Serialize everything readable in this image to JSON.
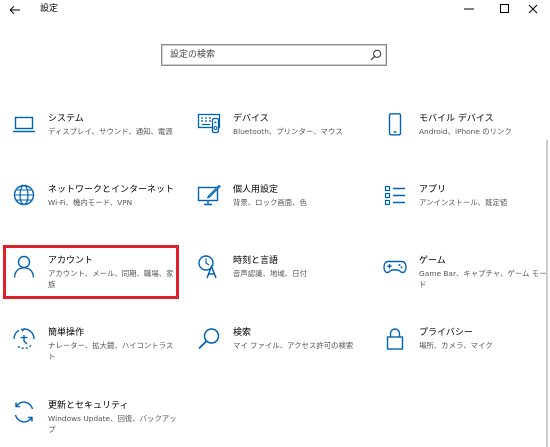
{
  "window": {
    "title": "設定"
  },
  "colors": {
    "accent": "#0063b1",
    "highlight": "#e0202a",
    "label": "#000000",
    "description": "#555555"
  },
  "search": {
    "placeholder": "設定の検索"
  },
  "items": [
    {
      "label": "システム",
      "description": "ディスプレイ、サウンド、通知、電源",
      "icon": "laptop-icon"
    },
    {
      "label": "デバイス",
      "description": "Bluetooth、プリンター、マウス",
      "icon": "keyboard-devices-icon"
    },
    {
      "label": "モバイル デバイス",
      "description": "Android、iPhone のリンク",
      "icon": "phone-icon"
    },
    {
      "label": "ネットワークとインターネット",
      "description": "Wi-Fi、機内モード、VPN",
      "icon": "globe-icon"
    },
    {
      "label": "個人用設定",
      "description": "背景、ロック画面、色",
      "icon": "personalization-icon"
    },
    {
      "label": "アプリ",
      "description": "アンインストール、既定値",
      "icon": "apps-list-icon"
    },
    {
      "label": "アカウント",
      "description": "アカウント、メール、同期、職場、家族",
      "icon": "person-icon"
    },
    {
      "label": "時刻と言語",
      "description": "音声認識、地域、日付",
      "icon": "time-language-icon"
    },
    {
      "label": "ゲーム",
      "description": "Game Bar、キャプチャ、ゲーム モード",
      "icon": "gamepad-icon"
    },
    {
      "label": "簡単操作",
      "description": "ナレーター、拡大鏡、ハイコントラスト",
      "icon": "ease-of-access-icon"
    },
    {
      "label": "検索",
      "description": "マイ ファイル、アクセス許可の検索",
      "icon": "search-icon"
    },
    {
      "label": "プライバシー",
      "description": "場所、カメラ、マイク",
      "icon": "lock-icon"
    },
    {
      "label": "更新とセキュリティ",
      "description": "Windows Update、回復、バックアップ",
      "icon": "sync-icon"
    }
  ]
}
